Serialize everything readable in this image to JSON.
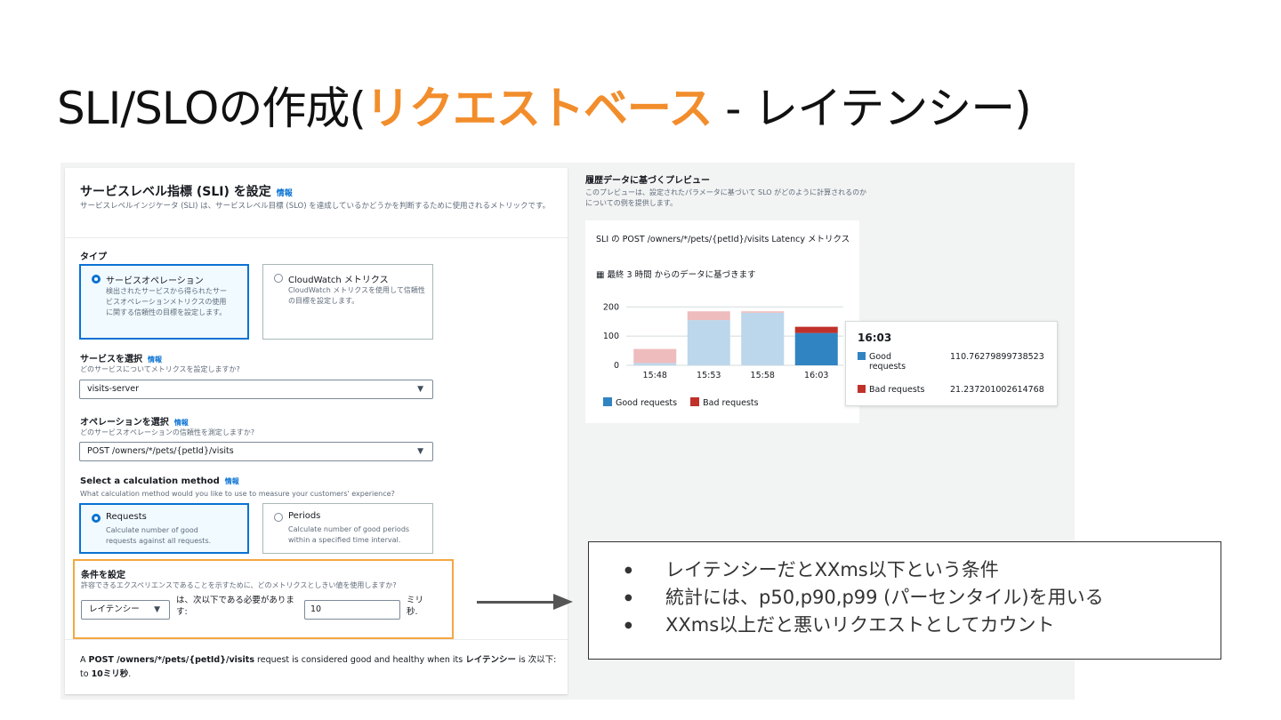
{
  "slide": {
    "title_prefix": "SLI/SLOの作成(",
    "title_highlight": "リクエストベース",
    "title_suffix": " - レイテンシー)"
  },
  "form": {
    "title": "サービスレベル指標 (SLI) を設定",
    "info": "情報",
    "description": "サービスレベルインジケータ (SLI) は、サービスレベル目標 (SLO) を達成しているかどうかを判断するために使用されるメトリックです。",
    "type_label": "タイプ",
    "type_options": [
      {
        "title": "サービスオペレーション",
        "desc": "検出されたサービスから得られたサービスオペレーションメトリクスの使用に関する信頼性の目標を設定します。",
        "selected": true
      },
      {
        "title": "CloudWatch メトリクス",
        "desc": "CloudWatch メトリクスを使用して信頼性の目標を設定します。",
        "selected": false
      }
    ],
    "service_label": "サービスを選択",
    "service_hint": "どのサービスについてメトリクスを設定しますか?",
    "service_value": "visits-server",
    "operation_label": "オペレーションを選択",
    "operation_hint": "どのサービスオペレーションの信頼性を測定しますか?",
    "operation_value": "POST /owners/*/pets/{petId}/visits",
    "calc_label": "Select a calculation method",
    "calc_hint": "What calculation method would you like to use to measure your customers' experience?",
    "calc_options": [
      {
        "title": "Requests",
        "desc": "Calculate number of good requests against all requests.",
        "selected": true
      },
      {
        "title": "Periods",
        "desc": "Calculate number of good periods within a specified time interval.",
        "selected": false
      }
    ],
    "condition_label": "条件を設定",
    "condition_hint": "許容できるエクスペリエンスであることを示すために、どのメトリクスとしきい値を使用しますか?",
    "metric_value": "レイテンシー",
    "condition_text": "は、次以下である必要があります:",
    "threshold_value": "10",
    "unit": "ミリ秒.",
    "footer_a": "A ",
    "footer_op": "POST /owners/*/pets/{petId}/visits",
    "footer_mid": " request is considered good and healthy when its ",
    "footer_metric": "レイテンシー",
    "footer_is": " is 次以下: to ",
    "footer_val": "10ミリ秒",
    "footer_end": "."
  },
  "preview": {
    "title": "履歴データに基づくプレビュー",
    "description": "このプレビューは、設定されたパラメータに基づいて SLO がどのように計算されるのかについての例を提供します。",
    "chart_title": "SLI の POST /owners/*/pets/{petId}/visits Latency メトリクス",
    "chart_subtitle": "最終 3 時間 からのデータに基づきます",
    "calendar_icon": "calendar-icon"
  },
  "chart_data": {
    "type": "bar",
    "stacked": true,
    "categories": [
      "15:48",
      "15:53",
      "15:58",
      "16:03"
    ],
    "series": [
      {
        "name": "Good requests",
        "values": [
          8,
          155,
          180,
          110.76
        ],
        "color": "#3184c2",
        "faded_color": "#bcd7ec"
      },
      {
        "name": "Bad requests",
        "values": [
          48,
          30,
          5,
          21.24
        ],
        "color": "#c0312a",
        "faded_color": "#eebcbc"
      }
    ],
    "highlighted_index": 3,
    "ylim": [
      0,
      210
    ],
    "yticks": [
      "0",
      "100",
      "200"
    ],
    "legend": "bottom"
  },
  "tooltip": {
    "time": "16:03",
    "good_label_1": "Good",
    "good_label_2": "requests",
    "good_value": "110.76279899738523",
    "bad_label": "Bad requests",
    "bad_value": "21.237201002614768"
  },
  "notes": [
    "レイテンシーだとXXms以下という条件",
    "統計には、p50,p90,p99 (パーセンタイル)を用いる",
    "XXms以上だと悪いリクエストとしてカウント"
  ],
  "colors": {
    "accent": "#f28d2c",
    "link": "#0972d3",
    "highlight_box": "#f5a742"
  }
}
